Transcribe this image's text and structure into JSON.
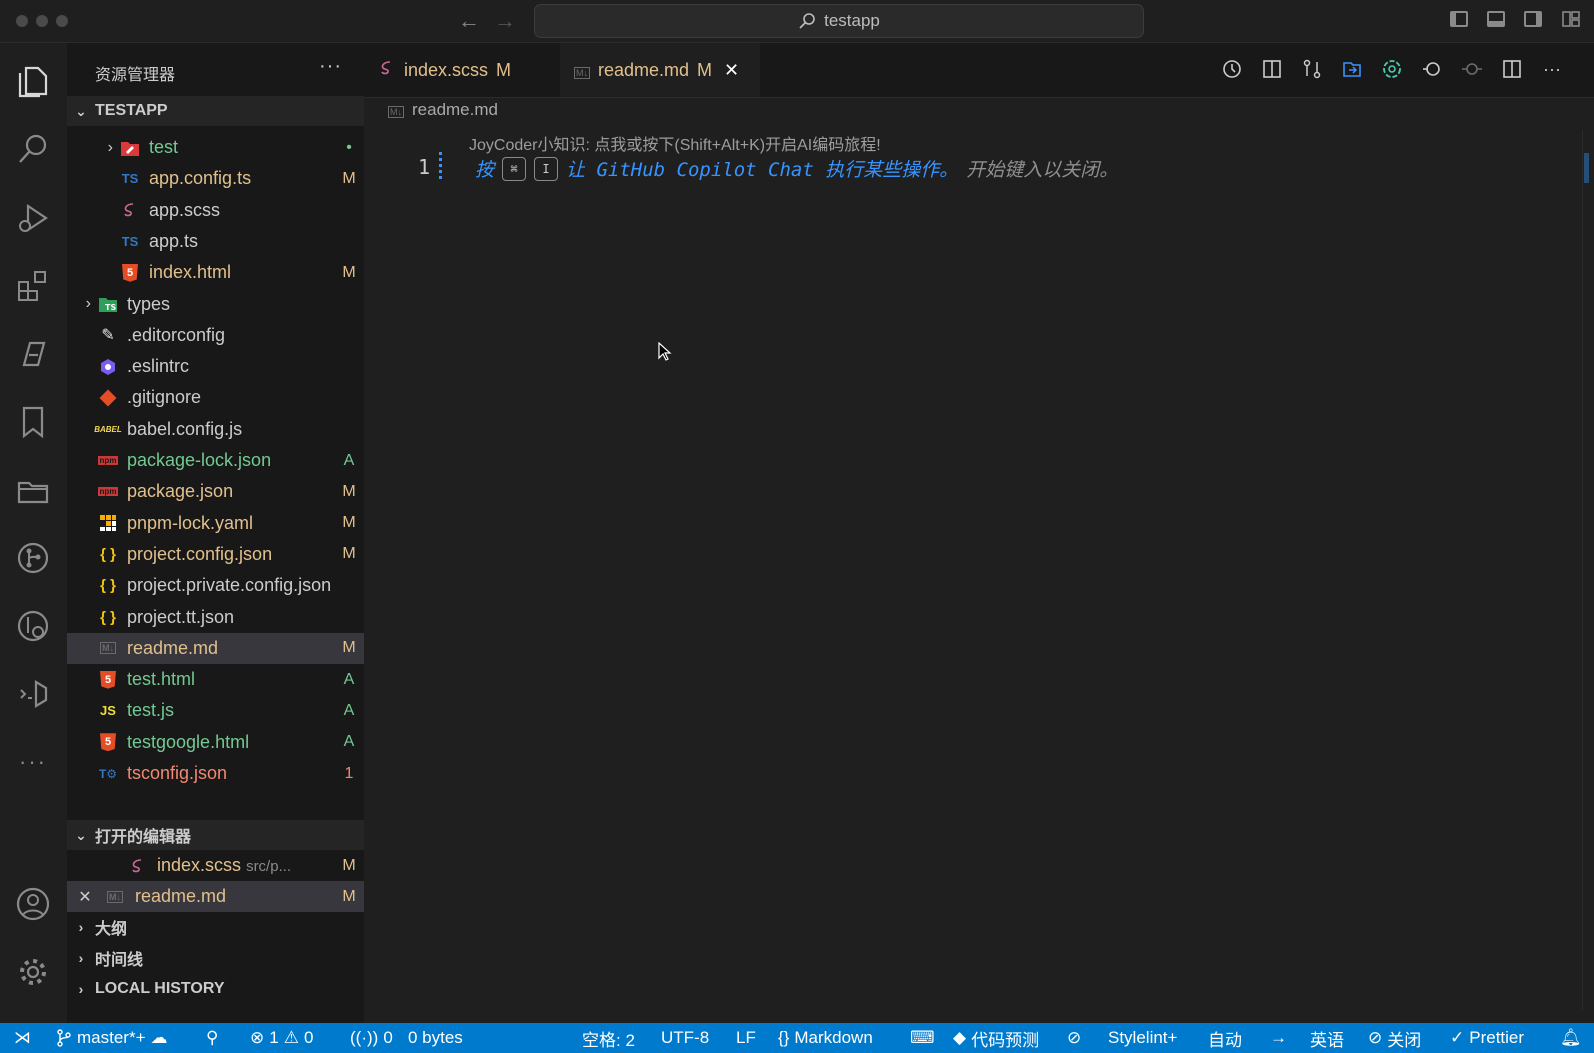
{
  "titlebar": {
    "search": "testapp"
  },
  "explorer": {
    "title": "资源管理器",
    "project": "TESTAPP",
    "files": [
      {
        "name": "test",
        "status": "•",
        "state": "add",
        "indent": 2,
        "chevron": true,
        "icon": "test-folder-icon"
      },
      {
        "name": "app.config.ts",
        "status": "M",
        "state": "mod",
        "indent": 2,
        "icon": "typescript-icon"
      },
      {
        "name": "app.scss",
        "status": "",
        "state": "norm",
        "indent": 2,
        "icon": "sass-icon"
      },
      {
        "name": "app.ts",
        "status": "",
        "state": "norm",
        "indent": 2,
        "icon": "typescript-icon"
      },
      {
        "name": "index.html",
        "status": "M",
        "state": "mod",
        "indent": 2,
        "icon": "html-icon"
      },
      {
        "name": "types",
        "status": "",
        "state": "norm",
        "indent": 1,
        "chevron": true,
        "icon": "types-folder-icon"
      },
      {
        "name": ".editorconfig",
        "status": "",
        "state": "norm",
        "indent": 1,
        "icon": "editorconfig-icon"
      },
      {
        "name": ".eslintrc",
        "status": "",
        "state": "norm",
        "indent": 1,
        "icon": "eslint-icon"
      },
      {
        "name": ".gitignore",
        "status": "",
        "state": "norm",
        "indent": 1,
        "icon": "git-icon"
      },
      {
        "name": "babel.config.js",
        "status": "",
        "state": "norm",
        "indent": 1,
        "icon": "babel-icon"
      },
      {
        "name": "package-lock.json",
        "status": "A",
        "state": "add",
        "indent": 1,
        "icon": "npm-icon"
      },
      {
        "name": "package.json",
        "status": "M",
        "state": "mod",
        "indent": 1,
        "icon": "npm-icon"
      },
      {
        "name": "pnpm-lock.yaml",
        "status": "M",
        "state": "mod",
        "indent": 1,
        "icon": "pnpm-icon"
      },
      {
        "name": "project.config.json",
        "status": "M",
        "state": "mod",
        "indent": 1,
        "icon": "json-icon"
      },
      {
        "name": "project.private.config.json",
        "status": "",
        "state": "norm",
        "indent": 1,
        "icon": "json-icon"
      },
      {
        "name": "project.tt.json",
        "status": "",
        "state": "norm",
        "indent": 1,
        "icon": "json-icon"
      },
      {
        "name": "readme.md",
        "status": "M",
        "state": "mod",
        "indent": 1,
        "icon": "markdown-icon",
        "selected": true
      },
      {
        "name": "test.html",
        "status": "A",
        "state": "add",
        "indent": 1,
        "icon": "html-icon"
      },
      {
        "name": "test.js",
        "status": "A",
        "state": "add",
        "indent": 1,
        "icon": "javascript-icon"
      },
      {
        "name": "testgoogle.html",
        "status": "A",
        "state": "add",
        "indent": 1,
        "icon": "html-icon"
      },
      {
        "name": "tsconfig.json",
        "status": "1",
        "state": "err",
        "indent": 1,
        "icon": "tsconfig-icon"
      }
    ]
  },
  "open_editors": {
    "title": "打开的编辑器",
    "items": [
      {
        "name": "index.scss",
        "path": "src/p...",
        "status": "M"
      },
      {
        "name": "readme.md",
        "path": "",
        "status": "M"
      }
    ]
  },
  "outline": {
    "title": "大纲"
  },
  "timeline": {
    "title": "时间线"
  },
  "local_history": {
    "title": "LOCAL HISTORY"
  },
  "tabs": [
    {
      "name": "index.scss",
      "status": "M"
    },
    {
      "name": "readme.md",
      "status": "M"
    }
  ],
  "editor": {
    "breadcrumb": "readme.md",
    "hint": "JoyCoder小知识: 点我或按下(Shift+Alt+K)开启AI编码旅程!",
    "line_number": "1",
    "ghost_prefix": "按",
    "key1": "⌘",
    "key2": "I",
    "ghost_main": "让 GitHub Copilot Chat 执行某些操作。",
    "ghost_dim": "开始键入以关闭。"
  },
  "statusbar": {
    "branch": "master*+",
    "errors": "1",
    "warnings": "0",
    "ports": "0",
    "size": "0 bytes",
    "spaces": "空格: 2",
    "encoding": "UTF-8",
    "eol": "LF",
    "language": "Markdown",
    "prediction": "代码预测",
    "stylelint": "Stylelint+",
    "auto": "自动",
    "lang_zh": "英语",
    "close": "关闭",
    "prettier": "Prettier"
  },
  "colors": {
    "accent": "#007acc",
    "modified": "#e2c08d",
    "added": "#73c991",
    "error": "#f48771",
    "ghost_text": "#3794ff"
  }
}
